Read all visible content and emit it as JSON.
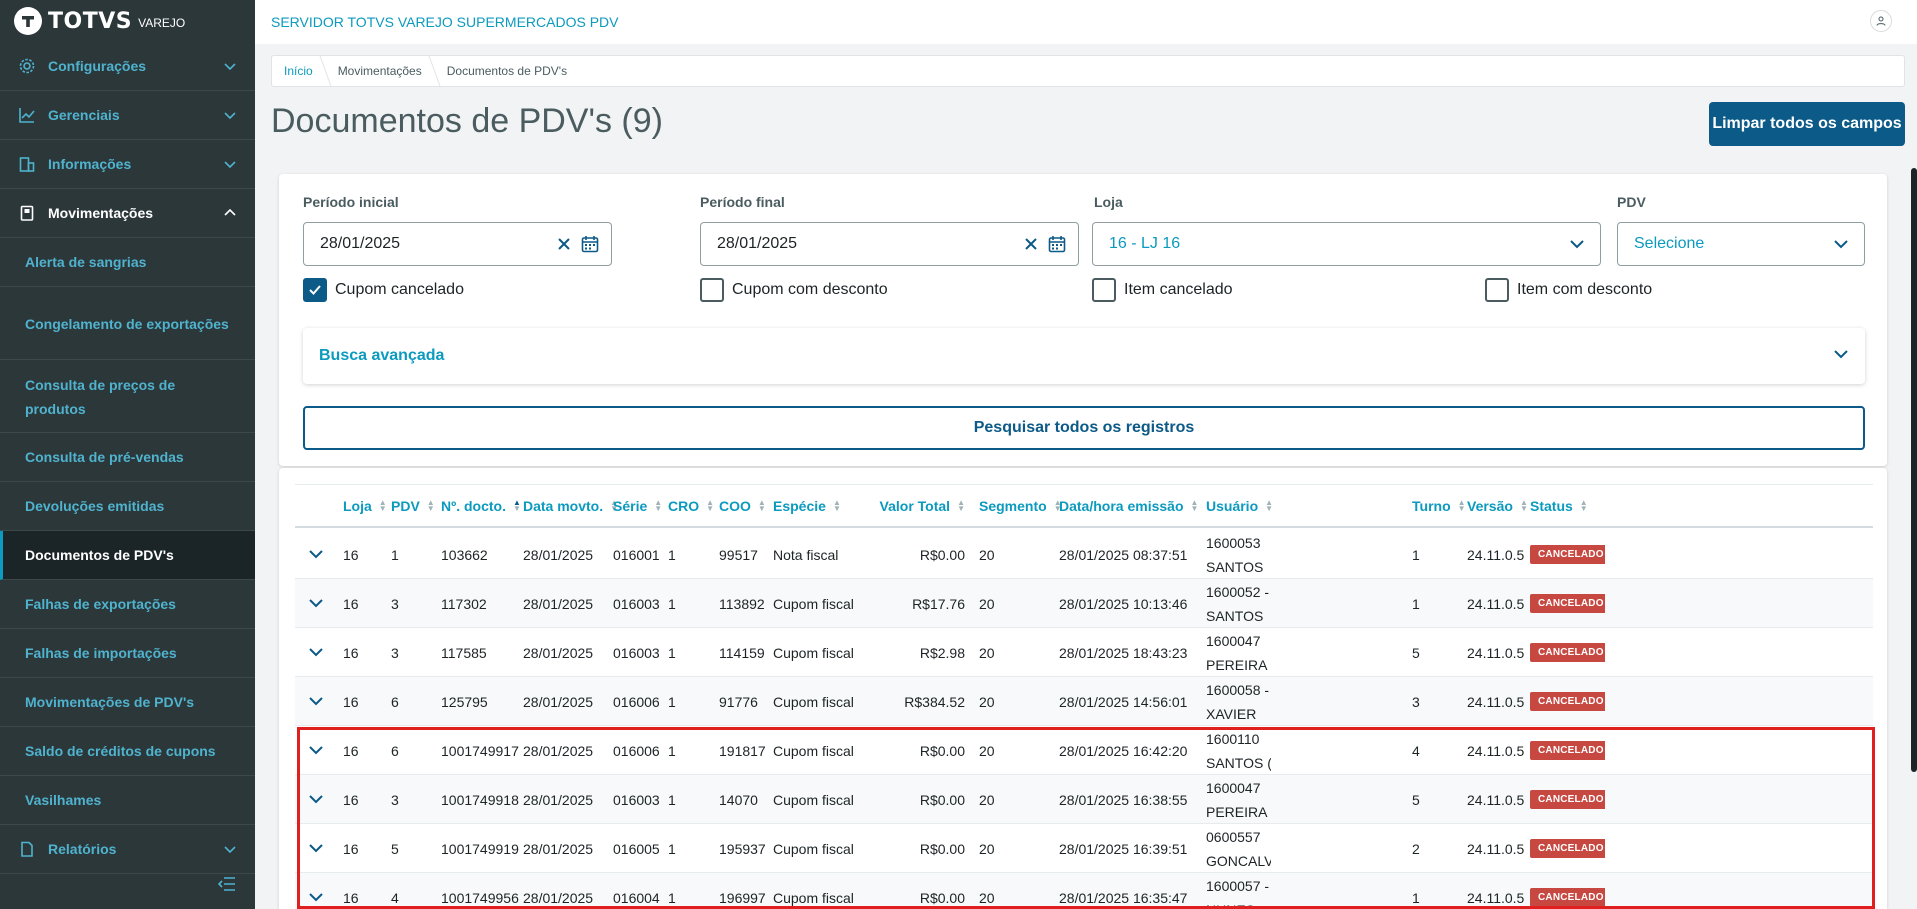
{
  "brand": {
    "name": "TOTVS",
    "product": "VAREJO"
  },
  "topbar": {
    "title": "SERVIDOR TOTVS VAREJO SUPERMERCADOS PDV"
  },
  "sidebar": {
    "menus": [
      {
        "label": "Configurações",
        "icon": "gear-icon"
      },
      {
        "label": "Gerenciais",
        "icon": "chart-icon"
      },
      {
        "label": "Informações",
        "icon": "building-icon"
      },
      {
        "label": "Movimentações",
        "icon": "clipboard-icon"
      }
    ],
    "subitems": [
      "Alerta de sangrias",
      "Congelamento de exportações",
      "Consulta de preços de produtos",
      "Consulta de pré-vendas",
      "Devoluções emitidas",
      "Documentos de PDV's",
      "Falhas de exportações",
      "Falhas de importações",
      "Movimentações de PDV's",
      "Saldo de créditos de cupons",
      "Vasilhames"
    ],
    "bottom_menu": {
      "label": "Relatórios",
      "icon": "report-icon"
    }
  },
  "breadcrumb": [
    "Início",
    "Movimentações",
    "Documentos de PDV's"
  ],
  "page": {
    "title": "Documentos de PDV's (9)",
    "clear_button": "Limpar todos os campos"
  },
  "filters": {
    "start_label": "Período inicial",
    "start_value": "28/01/2025",
    "end_label": "Período final",
    "end_value": "28/01/2025",
    "store_label": "Loja",
    "store_value": "16 - LJ 16",
    "pdv_label": "PDV",
    "pdv_placeholder": "Selecione",
    "checkboxes": [
      {
        "label": "Cupom cancelado",
        "checked": true
      },
      {
        "label": "Cupom com desconto",
        "checked": false
      },
      {
        "label": "Item cancelado",
        "checked": false
      },
      {
        "label": "Item com desconto",
        "checked": false
      }
    ],
    "advanced": "Busca avançada",
    "search_button": "Pesquisar todos os registros"
  },
  "table": {
    "columns": [
      "Loja",
      "PDV",
      "Nº. docto.",
      "Data movto.",
      "Série",
      "CRO",
      "COO",
      "Espécie",
      "Valor Total",
      "Segmento",
      "Data/hora emissão",
      "Usuário",
      "Turno",
      "Versão",
      "Status"
    ],
    "rows": [
      {
        "loja": "16",
        "pdv": "1",
        "docto": "103662",
        "data": "28/01/2025",
        "serie": "016001",
        "cro": "1",
        "coo": "99517",
        "especie": "Nota fiscal",
        "valor": "R$0.00",
        "segmento": "20",
        "emissao": "28/01/2025 08:37:51",
        "usuario1": "1600053",
        "usuario2": "SANTOS",
        "turno": "1",
        "versao": "24.11.0.5",
        "status": "CANCELADO"
      },
      {
        "loja": "16",
        "pdv": "3",
        "docto": "117302",
        "data": "28/01/2025",
        "serie": "016003",
        "cro": "1",
        "coo": "113892",
        "especie": "Cupom fiscal",
        "valor": "R$17.76",
        "segmento": "20",
        "emissao": "28/01/2025 10:13:46",
        "usuario1": "1600052 -",
        "usuario2": "SANTOS",
        "turno": "1",
        "versao": "24.11.0.5",
        "status": "CANCELADO"
      },
      {
        "loja": "16",
        "pdv": "3",
        "docto": "117585",
        "data": "28/01/2025",
        "serie": "016003",
        "cro": "1",
        "coo": "114159",
        "especie": "Cupom fiscal",
        "valor": "R$2.98",
        "segmento": "20",
        "emissao": "28/01/2025 18:43:23",
        "usuario1": "1600047",
        "usuario2": "PEREIRA",
        "turno": "5",
        "versao": "24.11.0.5",
        "status": "CANCELADO"
      },
      {
        "loja": "16",
        "pdv": "6",
        "docto": "125795",
        "data": "28/01/2025",
        "serie": "016006",
        "cro": "1",
        "coo": "91776",
        "especie": "Cupom fiscal",
        "valor": "R$384.52",
        "segmento": "20",
        "emissao": "28/01/2025 14:56:01",
        "usuario1": "1600058 -",
        "usuario2": "XAVIER",
        "turno": "3",
        "versao": "24.11.0.5",
        "status": "CANCELADO"
      },
      {
        "loja": "16",
        "pdv": "6",
        "docto": "1001749917",
        "data": "28/01/2025",
        "serie": "016006",
        "cro": "1",
        "coo": "191817",
        "especie": "Cupom fiscal",
        "valor": "R$0.00",
        "segmento": "20",
        "emissao": "28/01/2025 16:42:20",
        "usuario1": "1600110",
        "usuario2": "SANTOS (",
        "turno": "4",
        "versao": "24.11.0.5",
        "status": "CANCELADO"
      },
      {
        "loja": "16",
        "pdv": "3",
        "docto": "1001749918",
        "data": "28/01/2025",
        "serie": "016003",
        "cro": "1",
        "coo": "14070",
        "especie": "Cupom fiscal",
        "valor": "R$0.00",
        "segmento": "20",
        "emissao": "28/01/2025 16:38:55",
        "usuario1": "1600047",
        "usuario2": "PEREIRA",
        "turno": "5",
        "versao": "24.11.0.5",
        "status": "CANCELADO"
      },
      {
        "loja": "16",
        "pdv": "5",
        "docto": "1001749919",
        "data": "28/01/2025",
        "serie": "016005",
        "cro": "1",
        "coo": "195937",
        "especie": "Cupom fiscal",
        "valor": "R$0.00",
        "segmento": "20",
        "emissao": "28/01/2025 16:39:51",
        "usuario1": "0600557",
        "usuario2": "GONCALV",
        "turno": "2",
        "versao": "24.11.0.5",
        "status": "CANCELADO"
      },
      {
        "loja": "16",
        "pdv": "4",
        "docto": "1001749956",
        "data": "28/01/2025",
        "serie": "016004",
        "cro": "1",
        "coo": "196997",
        "especie": "Cupom fiscal",
        "valor": "R$0.00",
        "segmento": "20",
        "emissao": "28/01/2025 16:35:47",
        "usuario1": "1600057 -",
        "usuario2": "NUNES",
        "turno": "1",
        "versao": "24.11.0.5",
        "status": "CANCELADO"
      }
    ]
  },
  "colors": {
    "accent": "#0c9abe",
    "primary": "#0c5a87",
    "sidebar": "#2c3739",
    "status": "#c64840",
    "highlight": "#e01f1f"
  }
}
